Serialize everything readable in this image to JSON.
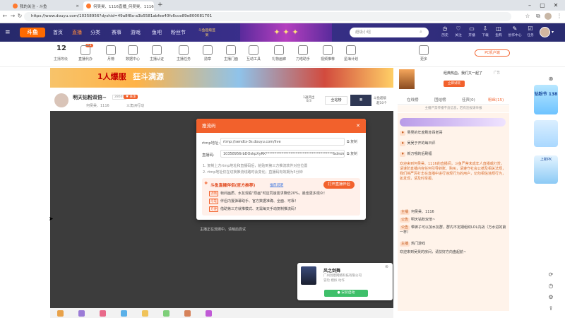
{
  "browser": {
    "tabs": [
      {
        "label": "我的关注 - 斗鱼"
      },
      {
        "label": "何吴昊、1116直播_何吴昊、1116..."
      }
    ],
    "url": "https://www.douyu.com/10358956?dyshid=49a8f8a-a3b5581abfee40fc6cce89e800081701"
  },
  "topnav": {
    "logo": "斗鱼",
    "items": [
      "首页",
      "直播",
      "分类",
      "赛事",
      "游戏",
      "鱼吧",
      "粉丝节"
    ],
    "active": "直播",
    "promo_label": "斗鱼超级签到",
    "search_placeholder": "超级小组",
    "right_icons": [
      {
        "icon": "history-icon",
        "label": "历史"
      },
      {
        "icon": "heart-icon",
        "label": "关注"
      },
      {
        "icon": "broadcast-icon",
        "label": "开播"
      },
      {
        "icon": "download-icon",
        "label": "下载"
      },
      {
        "icon": "mall-icon",
        "label": "鱼购"
      },
      {
        "icon": "creator-icon",
        "label": "创作中心"
      },
      {
        "icon": "task-icon",
        "label": "任务"
      }
    ]
  },
  "catbar": {
    "level": "12",
    "level_label": "主播等级",
    "items": [
      "直播代办",
      "月榜",
      "数据中心",
      "主播认证",
      "主播任务",
      "勋章",
      "主播门面",
      "互动工具",
      "礼物画廊",
      "刀塔助手",
      "视频推荐",
      "星海计划",
      "更多"
    ],
    "right_button": "PC机户端",
    "plus_badge": "+1"
  },
  "ad": {
    "left_text": "1人爆服",
    "left_text2": "狂斗满源",
    "right_title": "经典热血，我们又一起了",
    "right_sub": "立即试玩",
    "right_badge": "广告"
  },
  "stream": {
    "title": "明天钻粉双倍~",
    "hot": "28640",
    "streamer": "何吴昊、1116",
    "sub_label": "三角洲行动",
    "stats_label": "1通风出",
    "stats_value": "0/3",
    "follow_btn": "全站榜",
    "guild_label": "斗鱼超级",
    "rank_label": "超10个"
  },
  "modal": {
    "title": "推流码",
    "close": "✕",
    "rtmp_label": "rtmp地址:",
    "rtmp_value": "rtmp://sendtx-3s.douyu.com/live",
    "code_label": "直播码:",
    "code_value": "10358956rbDOskpXyRK**************************************&dnoinecognition=0",
    "copy": "复制",
    "hint1": "1. 复制上方rtmp地址和直播码后，粘贴到第三方推流软件对应位置",
    "hint2": "2. rtmp地址仅在切换推流线路时会变化；直播码有效期为5分钟",
    "promo_title": "斗鱼直播伴侣(官方推荐)",
    "promo_link": "推荐说明",
    "open_btn": "打开直播伴侣",
    "lines": [
      {
        "tag": "流畅",
        "text": "帧间画质、水友观看\"原画\"时应同速需求降低20%，最佳更多观众！"
      },
      {
        "tag": "可靠",
        "text": "伴侣内置弹幕助手、官方数据准确、全面、可靠！"
      },
      {
        "tag": "方便",
        "text": "借助第三方就推模式、无需每天手动复制推流码！"
      }
    ]
  },
  "player": {
    "note": "主播正在流媒中，请稍后尝试",
    "game_title": "风之剑舞",
    "game_company": "广州创意网络科技有限公司",
    "game_tags": [
      "冒险",
      "模拟",
      "动作"
    ],
    "game_btn": "● 安装启动"
  },
  "right": {
    "tabs": [
      "在线榜",
      "团结榜",
      "佳宾(0)",
      "粉丝(15)"
    ],
    "notice": "主播严禁传播不良信息，若有违规请举报",
    "chat": [
      {
        "badge": "",
        "text": "吴吴的年度刷赤昂老哥"
      },
      {
        "badge": "",
        "text": "吴吴于开的每日评"
      },
      {
        "badge": "",
        "text": "新万哦的后刷福"
      },
      {
        "badge": "",
        "text": "欢迎来到何吴昊、1116的直播间，斗鱼严禁未成年人直播或打赏，请谨防直播内容任何引导转账、购买，请遵守社会公德及相关法规，我们将严厉打击在直播中进行违规行为的用户，切勿相信违规行为，如发现，请及时举报。"
      },
      {
        "badge": "主播",
        "text": "何吴昊、1116"
      },
      {
        "badge": "公告",
        "text": "明天钻粉双倍~"
      },
      {
        "badge": "公告",
        "text": "带裤子可以加水友群，群内不定期组织LOL内战（万水进的第一杯）"
      },
      {
        "badge": "主播",
        "text": "热门游戏"
      },
      {
        "badge": "",
        "text": "欢迎来到吴昊的房间，请扶好方向盘起航~"
      }
    ]
  },
  "sidebar": {
    "banner1": "钻粉节 138",
    "banner2": "上新PK"
  },
  "colors": {
    "accent": "#f2612c",
    "nav_bg": "#2b2f74",
    "player_bg": "#3c3c3c"
  }
}
